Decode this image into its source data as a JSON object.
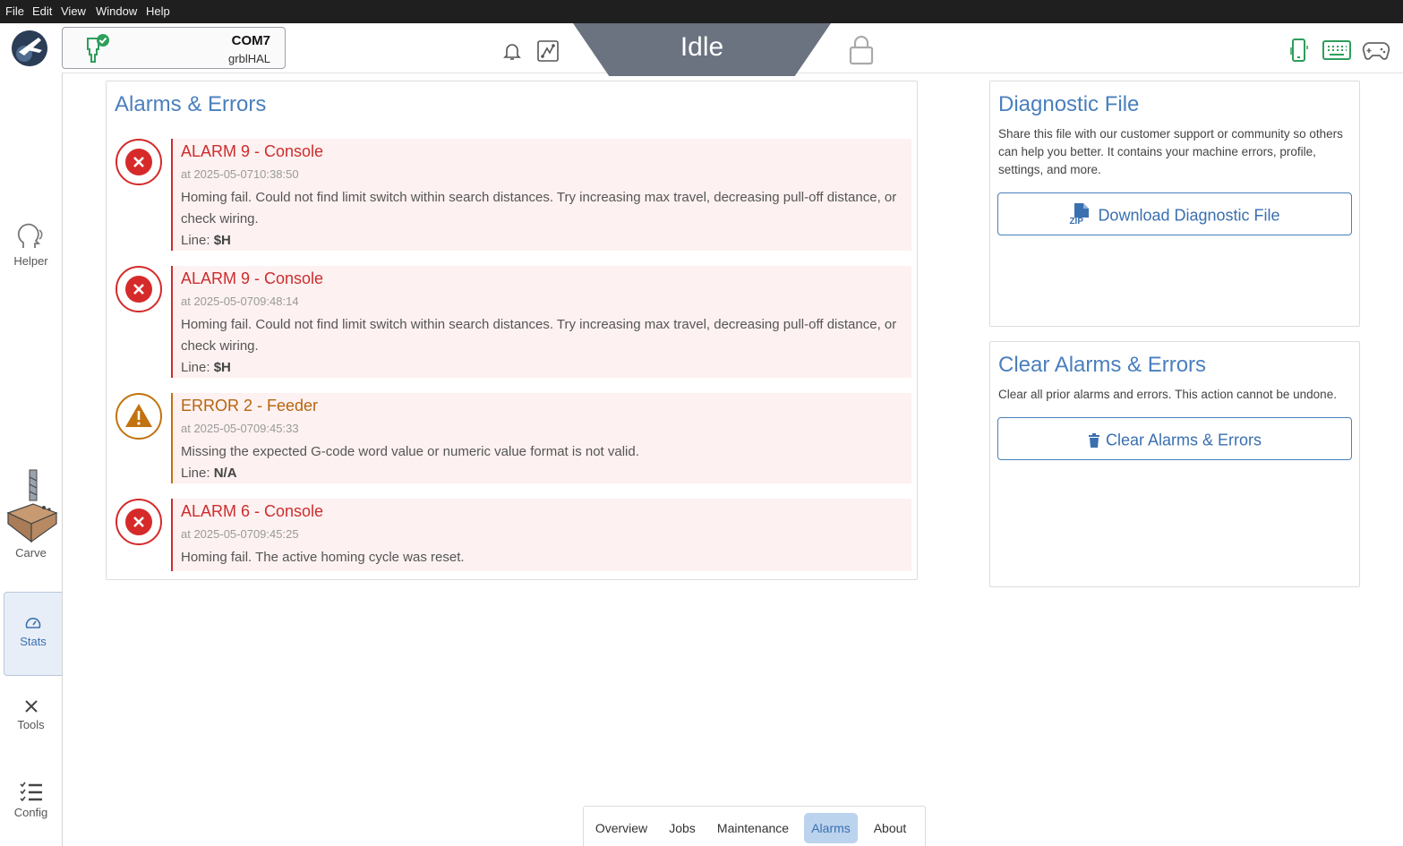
{
  "menubar": {
    "items": [
      "File",
      "Edit",
      "View",
      "Window",
      "Help"
    ]
  },
  "topbar": {
    "port": "COM7",
    "firmware": "grblHAL",
    "state": "Idle",
    "icons": [
      "bell-icon",
      "firmware-chip-icon",
      "lock-icon",
      "phone-icon",
      "keyboard-icon",
      "gamepad-icon"
    ],
    "colors": {
      "state_bg": "#6b7280",
      "connected": "#2e9e5b"
    }
  },
  "sidebar": {
    "items": [
      {
        "label": "Helper",
        "icon": "helper-head-icon"
      },
      {
        "label": "Carve",
        "icon": "carve-router-icon"
      },
      {
        "label": "Stats",
        "icon": "gauge-icon"
      },
      {
        "label": "Tools",
        "icon": "tools-cross-icon"
      },
      {
        "label": "Config",
        "icon": "checklist-icon"
      }
    ]
  },
  "alarms_panel": {
    "title": "Alarms & Errors",
    "entries": [
      {
        "type": "alarm",
        "title": "ALARM 9 - Console",
        "time": "at 2025-05-0710:38:50",
        "message": "Homing fail. Could not find limit switch within search distances. Try increasing max travel, decreasing pull-off distance, or check wiring.",
        "line_label": "Line:",
        "line_value": "$H"
      },
      {
        "type": "alarm",
        "title": "ALARM 9 - Console",
        "time": "at 2025-05-0709:48:14",
        "message": "Homing fail. Could not find limit switch within search distances. Try increasing max travel, decreasing pull-off distance, or check wiring.",
        "line_label": "Line:",
        "line_value": "$H"
      },
      {
        "type": "error",
        "title": "ERROR 2 - Feeder",
        "time": "at 2025-05-0709:45:33",
        "message": "Missing the expected G-code word value or numeric value format is not valid.",
        "line_label": "Line:",
        "line_value": "N/A"
      },
      {
        "type": "alarm",
        "title": "ALARM 6 - Console",
        "time": "at 2025-05-0709:45:25",
        "message": "Homing fail. The active homing cycle was reset."
      }
    ],
    "colors": {
      "alarm": "#cc2d2d",
      "error": "#b5650d",
      "entry_bg": "#fdf1f1"
    }
  },
  "diagnostic": {
    "title": "Diagnostic File",
    "description": "Share this file with our customer support or community so others can help you better. It contains your machine errors, profile, settings, and more.",
    "button_label": "Download Diagnostic File",
    "button_icon_text": "ZIP"
  },
  "clear": {
    "title": "Clear Alarms & Errors",
    "description": "Clear all prior alarms and errors. This action cannot be undone.",
    "button_label": "Clear Alarms & Errors"
  },
  "tabs": {
    "items": [
      "Overview",
      "Jobs",
      "Maintenance",
      "Alarms",
      "About"
    ],
    "active": "Alarms"
  }
}
